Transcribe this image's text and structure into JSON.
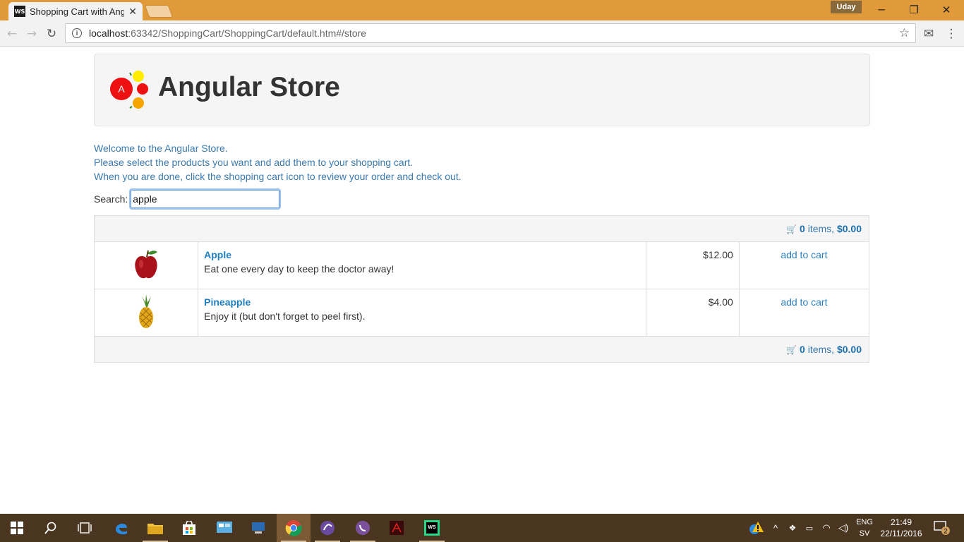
{
  "browser": {
    "tab_title": "Shopping Cart with Angu",
    "tab_favicon": "WS",
    "user_badge": "Uday",
    "url_host": "localhost",
    "url_path": ":63342/ShoppingCart/ShoppingCart/default.htm#/store"
  },
  "store": {
    "title": "Angular Store",
    "logo_letter": "A",
    "welcome_lines": [
      "Welcome to the Angular Store.",
      "Please select the products you want and add them to your shopping cart.",
      "When you are done, click the shopping cart icon to review your order and check out."
    ],
    "search_label": "Search:",
    "search_value": "apple",
    "cart": {
      "count": "0",
      "items_label": " items, ",
      "total": "$0.00"
    },
    "products": [
      {
        "name": "Apple",
        "description": "Eat one every day to keep the doctor away!",
        "price": "$12.00",
        "action": "add to cart",
        "image_icon": "apple-image"
      },
      {
        "name": "Pineapple",
        "description": "Enjoy it (but don't forget to peel first).",
        "price": "$4.00",
        "action": "add to cart",
        "image_icon": "pineapple-image"
      }
    ]
  },
  "taskbar": {
    "language": "ENG",
    "locale": "SV",
    "time": "21:49",
    "date": "22/11/2016",
    "notification_count": "2"
  },
  "colors": {
    "titlebar": "#e09a3a",
    "link": "#1f7fc0",
    "welcome_text": "#3a7ab0",
    "taskbar": "#4a3520"
  }
}
